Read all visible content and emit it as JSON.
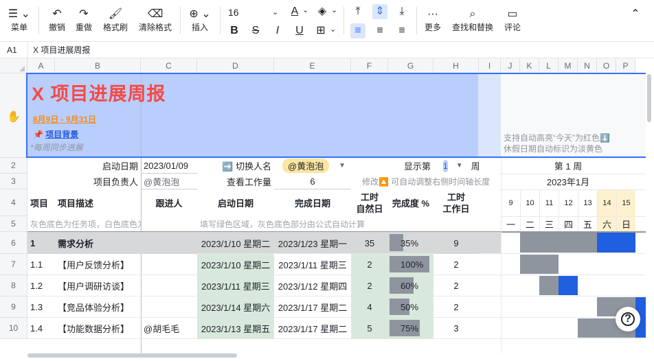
{
  "toolbar": {
    "menu": "菜单",
    "undo": "撤销",
    "redo": "重做",
    "format_painter": "格式刷",
    "clear_format": "清除格式",
    "insert": "插入",
    "font_size": "16",
    "more": "更多",
    "find_replace": "查找和替换",
    "comment": "评论",
    "text_color_glyph": "A",
    "bold_glyph": "B",
    "strike_glyph": "S",
    "italic_glyph": "I",
    "underline_glyph": "U"
  },
  "formula_bar": {
    "cell_ref": "A1",
    "content": "X 项目进展周报"
  },
  "columns": [
    "A",
    "B",
    "C",
    "D",
    "E",
    "F",
    "G",
    "H",
    "I",
    "J",
    "K",
    "L",
    "M",
    "N",
    "O",
    "P"
  ],
  "rows": [
    "1",
    "2",
    "3",
    "4",
    "5",
    "6",
    "7",
    "8",
    "9",
    "10"
  ],
  "banner": {
    "title": "X 项目进展周报",
    "date_range": "8月9日 - 9月31日",
    "background_link": "项目背景",
    "pin_glyph": "📌",
    "weekly_note": "*每周同步进展",
    "hint_line1": "支持自动高亮“今天”为红色⬇️",
    "hint_line2": "休假日期自动标识为淡黄色"
  },
  "header_rows": {
    "start_date_label": "启动日期",
    "start_date_value": "2023/01/09",
    "switch_person_label": "➡️ 切换人名",
    "switch_person_value": "@黄泡泡",
    "display_label": "显示第",
    "display_value": "1",
    "week_unit": "周",
    "week_title": "第 1 周",
    "owner_label": "项目负责人",
    "owner_value": "@黄泡泡",
    "workload_label": "查看工作量",
    "workload_value": "6",
    "modify_hint": "修改🔼 可自动调整右侧时间轴长度",
    "month_title": "2023年1月"
  },
  "table_headers": {
    "item": "项目",
    "desc": "项目描述",
    "follower": "跟进人",
    "start": "启动日期",
    "end": "完成日期",
    "natural_days": "工时\n自然日",
    "progress": "完成度 %",
    "work_days": "工时\n工作日"
  },
  "hints": {
    "gray_hint": "灰色底色为任务项，白色底色为",
    "green_hint": "填写绿色区域，灰色底色部分由公式自动计算"
  },
  "calendar": {
    "days": [
      "9",
      "10",
      "11",
      "12",
      "13",
      "14",
      "15"
    ],
    "weekdays": [
      "一",
      "二",
      "三",
      "四",
      "五",
      "六",
      "日"
    ]
  },
  "tasks": [
    {
      "id": "1",
      "name": "需求分析",
      "follower": "",
      "start": "2023/1/10 星期二",
      "end": "2023/1/23 星期一",
      "natural": "35",
      "progress": "35%",
      "progress_value": 35,
      "work": "9"
    },
    {
      "id": "1.1",
      "name": "【用户反馈分析】",
      "follower": "",
      "start": "2023/1/10 星期二",
      "end": "2023/1/11 星期三",
      "natural": "2",
      "progress": "100%",
      "progress_value": 100,
      "work": "2"
    },
    {
      "id": "1.2",
      "name": "【用户调研访谈】",
      "follower": "",
      "start": "2023/1/11 星期三",
      "end": "2023/1/12 星期四",
      "natural": "2",
      "progress": "60%",
      "progress_value": 60,
      "work": "2"
    },
    {
      "id": "1.3",
      "name": "【竞品体验分析】",
      "follower": "",
      "start": "2023/1/14 星期六",
      "end": "2023/1/17 星期二",
      "natural": "4",
      "progress": "50%",
      "progress_value": 50,
      "work": "2"
    },
    {
      "id": "1.4",
      "name": "【功能数据分析】",
      "follower": "@胡毛毛",
      "start": "2023/1/13 星期五",
      "end": "2023/1/17 星期二",
      "natural": "5",
      "progress": "75%",
      "progress_value": 75,
      "work": "3"
    }
  ],
  "colors": {
    "accent": "#3370ff",
    "banner_bg": "#bacefd",
    "title_red": "#f54a45",
    "date_orange": "#f28c1b",
    "green_fill": "#d9e8dc",
    "gray_fill": "#d7d8d9",
    "gantt_gray": "#8f959e",
    "gantt_blue": "#1f5fe0",
    "weekend_yellow": "#fdf1cf"
  }
}
